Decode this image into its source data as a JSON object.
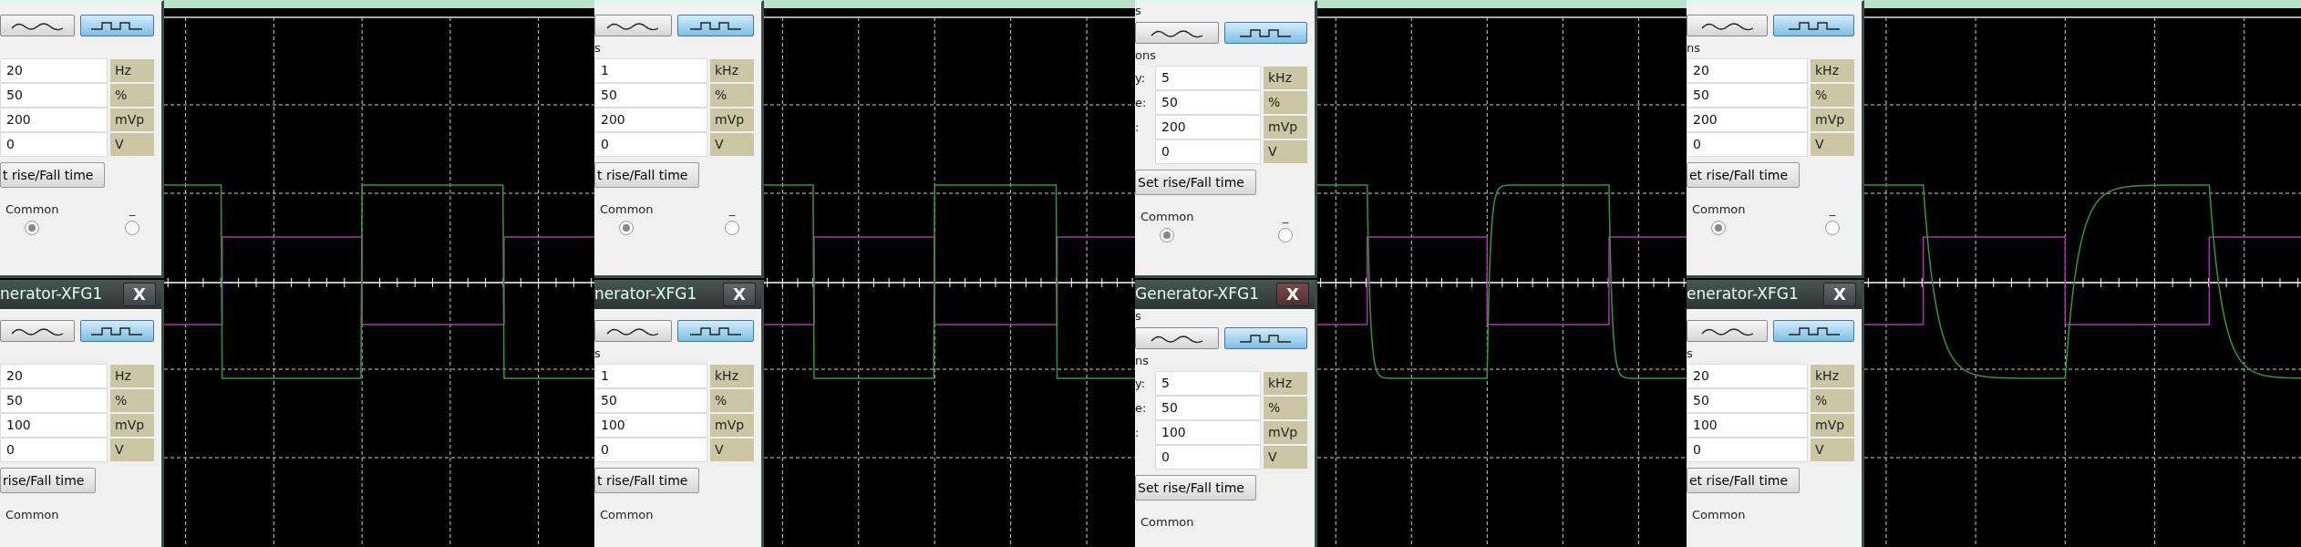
{
  "panels": [
    {
      "trace": {
        "kind": "sharp"
      },
      "dialogs": [
        {
          "waves": [
            {
              "kind": "sine",
              "selected": false
            },
            {
              "kind": "square",
              "selected": true
            }
          ],
          "fields": [
            {
              "value": "20",
              "unit": "Hz"
            },
            {
              "value": "50",
              "unit": "%"
            },
            {
              "value": "200",
              "unit": "mVp"
            },
            {
              "value": "0",
              "unit": "V"
            }
          ],
          "rise_fall_button": "t rise/Fall time",
          "terminals": [
            {
              "label": "Common",
              "selected": true
            },
            {
              "label": "_",
              "selected": false
            }
          ]
        },
        {
          "title": "nerator-XFG1",
          "close": "X",
          "waves": [
            {
              "kind": "sine",
              "selected": false
            },
            {
              "kind": "square",
              "selected": true
            }
          ],
          "fields": [
            {
              "value": "20",
              "unit": "Hz"
            },
            {
              "value": "50",
              "unit": "%"
            },
            {
              "value": "100",
              "unit": "mVp"
            },
            {
              "value": "0",
              "unit": "V"
            }
          ],
          "rise_fall_button": "rise/Fall time",
          "terminals": [
            {
              "label": "Common"
            }
          ]
        }
      ]
    },
    {
      "trace": {
        "kind": "sharp"
      },
      "dialogs": [
        {
          "waves": [
            {
              "kind": "sine",
              "selected": false
            },
            {
              "kind": "square",
              "selected": true
            }
          ],
          "options_label": "s",
          "fields": [
            {
              "value": "1",
              "unit": "kHz"
            },
            {
              "value": "50",
              "unit": "%"
            },
            {
              "value": "200",
              "unit": "mVp"
            },
            {
              "value": "0",
              "unit": "V"
            }
          ],
          "rise_fall_button": "t rise/Fall time",
          "terminals": [
            {
              "label": "Common",
              "selected": true
            },
            {
              "label": "_",
              "selected": false
            }
          ]
        },
        {
          "title": "nerator-XFG1",
          "close": "X",
          "waves": [
            {
              "kind": "sine",
              "selected": false
            },
            {
              "kind": "square",
              "selected": true
            }
          ],
          "options_label": "s",
          "fields": [
            {
              "value": "1",
              "unit": "kHz"
            },
            {
              "value": "50",
              "unit": "%"
            },
            {
              "value": "100",
              "unit": "mVp"
            },
            {
              "value": "0",
              "unit": "V"
            }
          ],
          "rise_fall_button": "t rise/Fall time",
          "terminals": [
            {
              "label": "Common"
            }
          ]
        }
      ]
    },
    {
      "trace": {
        "kind": "rounded"
      },
      "dialogs": [
        {
          "section_label": "s",
          "waves": [
            {
              "kind": "sine",
              "selected": false
            },
            {
              "kind": "square",
              "selected": true
            }
          ],
          "options_label": "ons",
          "fields": [
            {
              "label": "y:",
              "value": "5",
              "unit": "kHz"
            },
            {
              "label": "e:",
              "value": "50",
              "unit": "%"
            },
            {
              "label": ":",
              "value": "200",
              "unit": "mVp"
            },
            {
              "value": "0",
              "unit": "V"
            }
          ],
          "rise_fall_button": "Set rise/Fall time",
          "terminals": [
            {
              "label": "Common",
              "selected": true
            },
            {
              "label": "_",
              "selected": false
            }
          ]
        },
        {
          "title": "Generator-XFG1",
          "close": "X",
          "section_label": "s",
          "waves": [
            {
              "kind": "sine",
              "selected": false
            },
            {
              "kind": "square",
              "selected": true
            }
          ],
          "options_label": "ns",
          "fields": [
            {
              "label": "y:",
              "value": "5",
              "unit": "kHz"
            },
            {
              "label": "e:",
              "value": "50",
              "unit": "%"
            },
            {
              "label": ":",
              "value": "100",
              "unit": "mVp"
            },
            {
              "value": "0",
              "unit": "V"
            }
          ],
          "rise_fall_button": "Set rise/Fall time",
          "terminals": [
            {
              "label": "Common"
            }
          ]
        }
      ]
    },
    {
      "trace": {
        "kind": "slow"
      },
      "dialogs": [
        {
          "waves": [
            {
              "kind": "sine",
              "selected": false
            },
            {
              "kind": "square",
              "selected": true
            }
          ],
          "options_label": "ns",
          "fields": [
            {
              "value": "20",
              "unit": "kHz"
            },
            {
              "value": "50",
              "unit": "%"
            },
            {
              "value": "200",
              "unit": "mVp"
            },
            {
              "value": "0",
              "unit": "V"
            }
          ],
          "rise_fall_button": "et rise/Fall time",
          "terminals": [
            {
              "label": "Common",
              "selected": true
            },
            {
              "label": "_",
              "selected": false
            }
          ]
        },
        {
          "title": "enerator-XFG1",
          "close": "X",
          "waves": [
            {
              "kind": "sine",
              "selected": false
            },
            {
              "kind": "square",
              "selected": true
            }
          ],
          "options_label": "s",
          "fields": [
            {
              "value": "20",
              "unit": "kHz"
            },
            {
              "value": "50",
              "unit": "%"
            },
            {
              "value": "100",
              "unit": "mVp"
            },
            {
              "value": "0",
              "unit": "V"
            }
          ],
          "rise_fall_button": "et rise/Fall time",
          "terminals": [
            {
              "label": "Common"
            }
          ]
        }
      ]
    }
  ]
}
